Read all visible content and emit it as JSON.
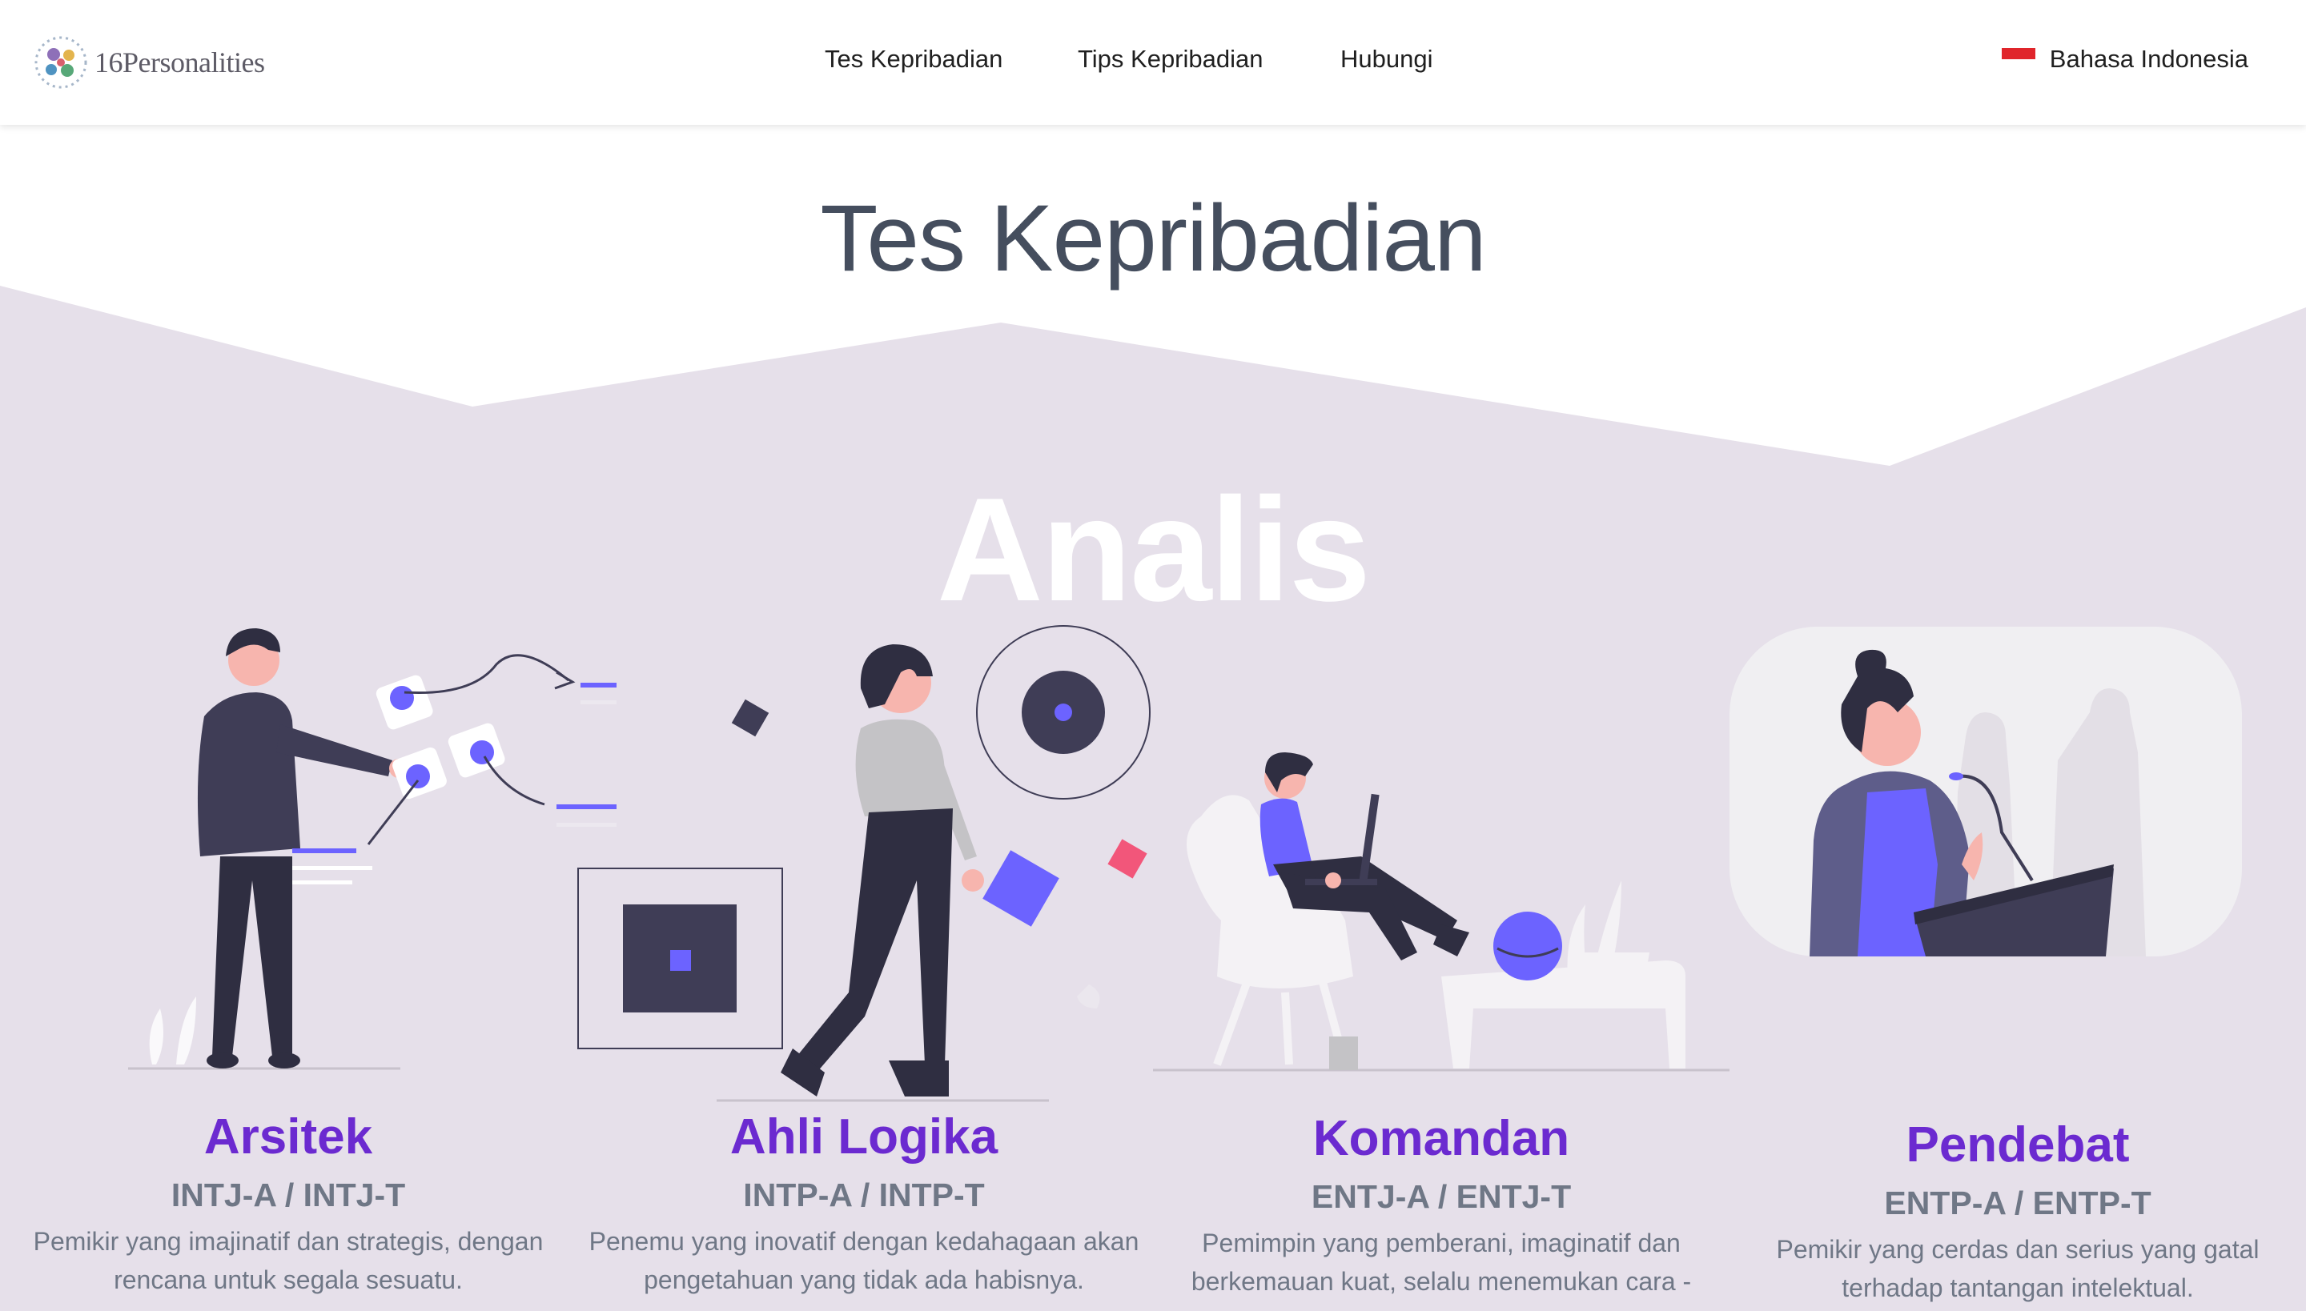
{
  "header": {
    "logo_text": "16Personalities",
    "nav": [
      {
        "label": "Tes Kepribadian"
      },
      {
        "label": "Tips Kepribadian"
      },
      {
        "label": "Hubungi"
      }
    ],
    "language": {
      "label": "Bahasa Indonesia",
      "flag": "indonesia-flag"
    }
  },
  "page": {
    "title": "Tes Kepribadian",
    "group": "Analis"
  },
  "cards": [
    {
      "name": "Arsitek",
      "code": "INTJ-A / INTJ-T",
      "desc": "Pemikir yang imajinatif dan strategis, dengan rencana untuk segala sesuatu."
    },
    {
      "name": "Ahli Logika",
      "code": "INTP-A / INTP-T",
      "desc": "Penemu yang inovatif dengan kedahagaan akan pengetahuan yang tidak ada habisnya."
    },
    {
      "name": "Komandan",
      "code": "ENTJ-A / ENTJ-T",
      "desc": "Pemimpin yang pemberani, imaginatif dan berkemauan kuat, selalu menemukan cara -"
    },
    {
      "name": "Pendebat",
      "code": "ENTP-A / ENTP-T",
      "desc": "Pemikir yang cerdas dan serius yang gatal terhadap tantangan intelektual."
    }
  ],
  "colors": {
    "accent": "#6b2ad0",
    "band": "#e6e0ea",
    "illustration_purple": "#6c63ff",
    "illustration_dark": "#3f3d56"
  }
}
